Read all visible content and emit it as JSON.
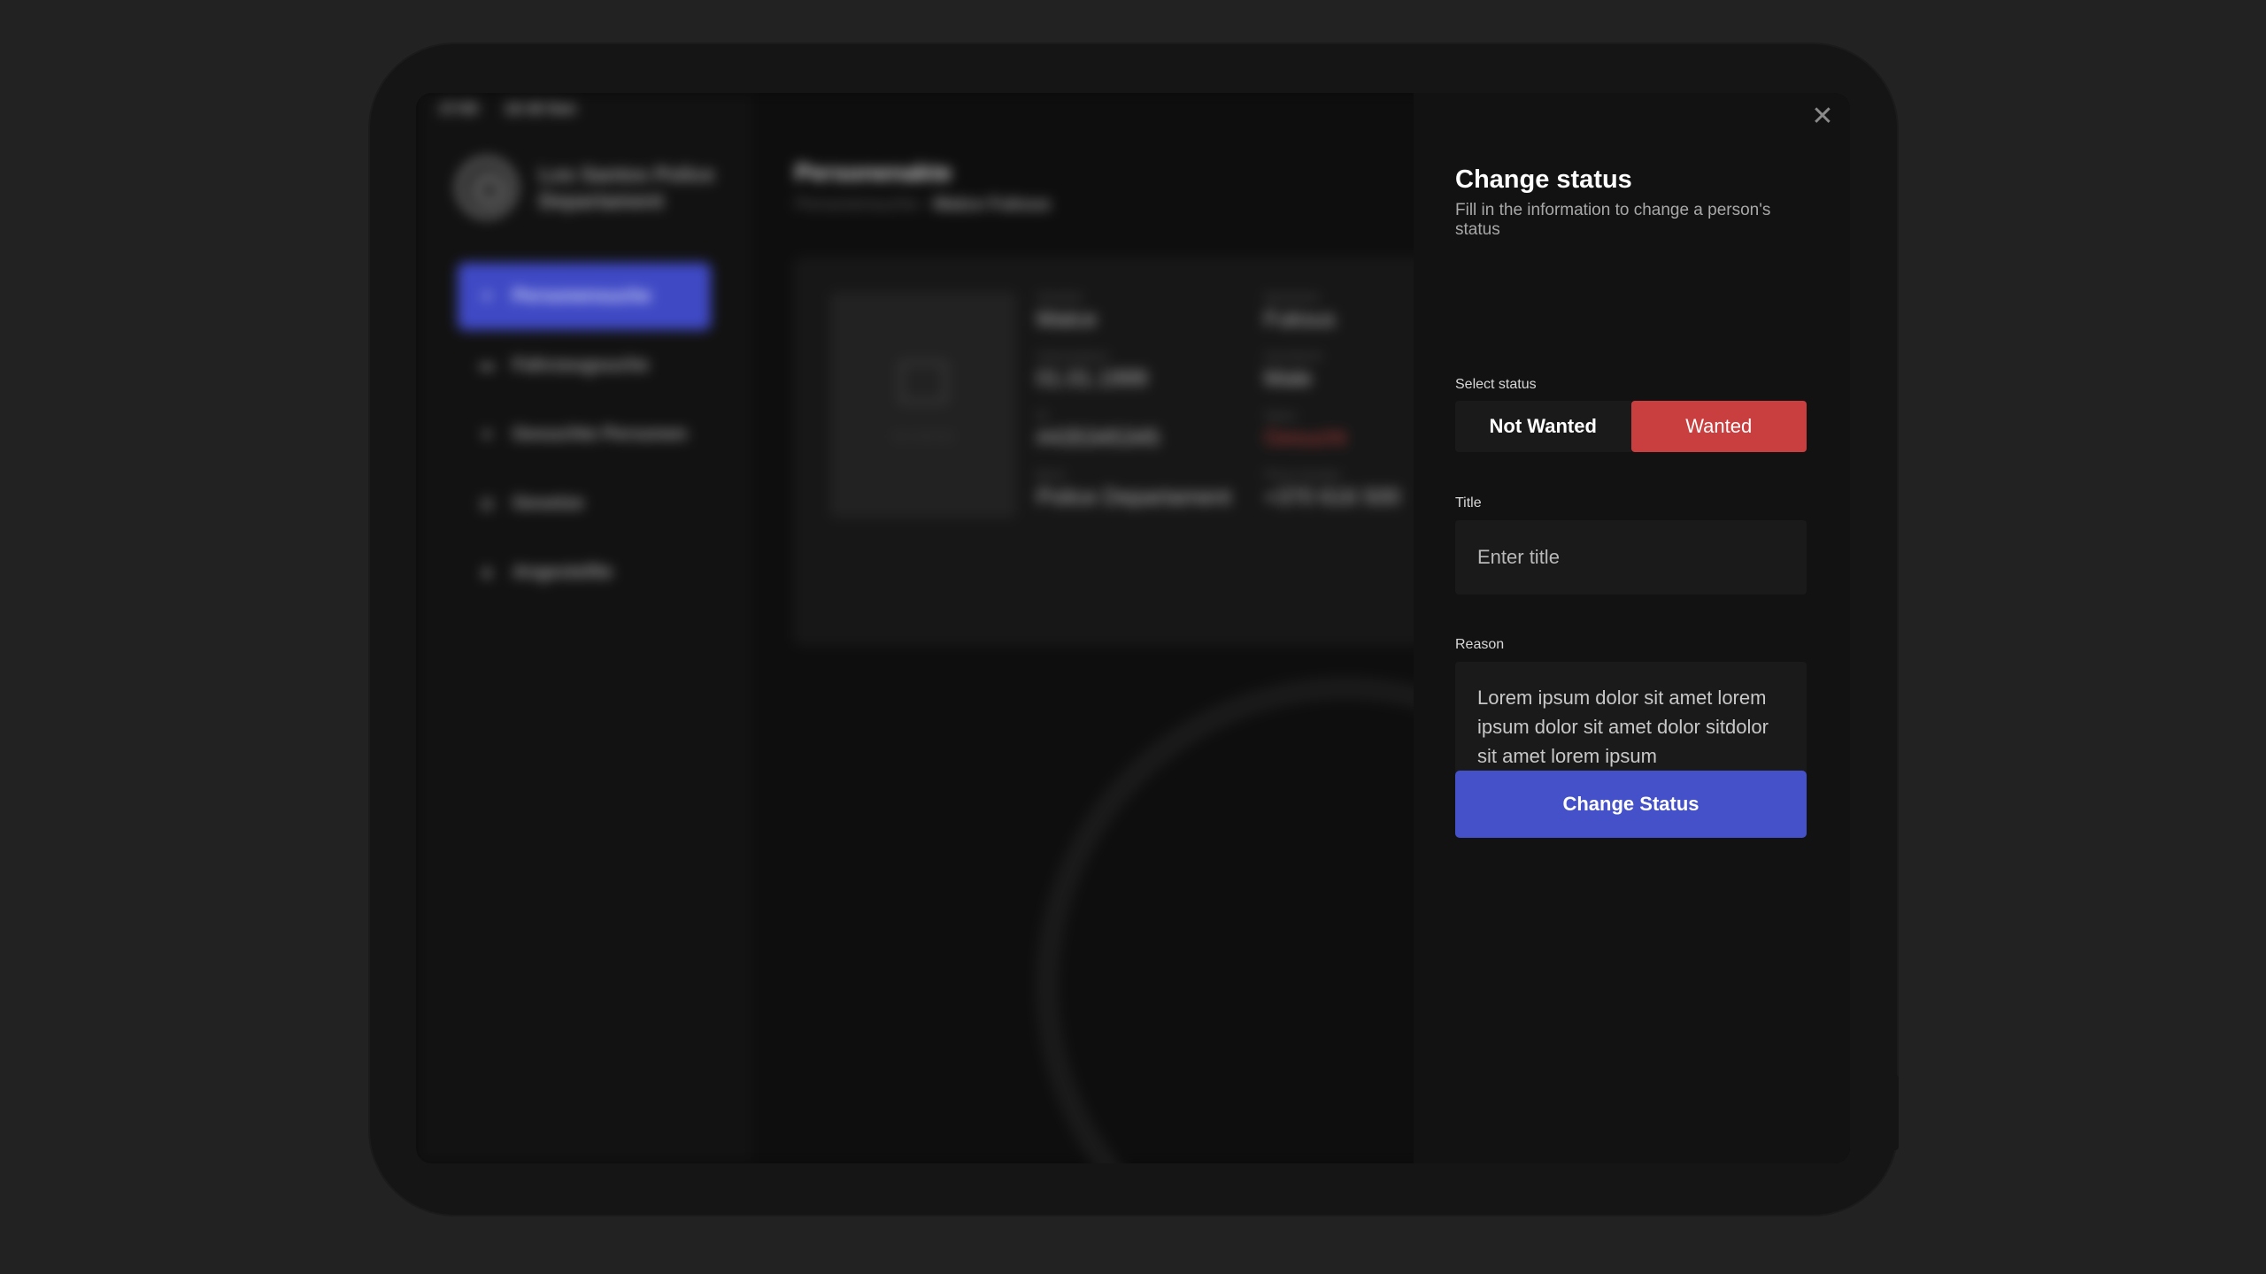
{
  "statusbar": {
    "time": "17:03",
    "date": "12-16 Sun"
  },
  "brand": {
    "name": "Los Santos Police Departament"
  },
  "sidebar": {
    "items": [
      {
        "label": "Personensuche",
        "icon": "person-icon",
        "active": true
      },
      {
        "label": "Fahrzeugsuche",
        "icon": "car-icon",
        "active": false
      },
      {
        "label": "Gesuchte Personen",
        "icon": "star-icon",
        "active": false
      },
      {
        "label": "Gesetze",
        "icon": "book-icon",
        "active": false
      },
      {
        "label": "Angestellte",
        "icon": "people-icon",
        "active": false
      }
    ]
  },
  "main": {
    "title": "Personenakte",
    "breadcrumb": {
      "parent": "Personensuche",
      "separator": "›",
      "current": "Matce Fuksus"
    },
    "person": {
      "photo_placeholder": "NO IMAGE",
      "fields": {
        "firstname": {
          "label": "Vorname",
          "value": "Matce"
        },
        "lastname": {
          "label": "Nachname",
          "value": "Fuksus"
        },
        "birthdate": {
          "label": "Geburtsdatum",
          "value": "01.01.1999"
        },
        "gender": {
          "label": "Geschlecht",
          "value": "Male"
        },
        "id": {
          "label": "ID",
          "value": "#435345345"
        },
        "status": {
          "label": "Status",
          "value": "Gesucht"
        },
        "job": {
          "label": "Beruf",
          "value": "Police Departament"
        },
        "phone": {
          "label": "Phone Number",
          "value": "+370 616 500"
        }
      }
    }
  },
  "panel": {
    "title": "Change status",
    "subtitle": "Fill in the information to change a person's status",
    "select_label": "Select status",
    "options": {
      "not_wanted": "Not Wanted",
      "wanted": "Wanted"
    },
    "selected": "Wanted",
    "title_label": "Title",
    "title_placeholder": "Enter title",
    "reason_label": "Reason",
    "reason_value": "Lorem ipsum dolor sit amet lorem ipsum dolor sit amet dolor sitdolor sit amet lorem ipsum",
    "submit_label": "Change Status",
    "close_glyph": "✕"
  },
  "colors": {
    "accent": "#4451c9",
    "wanted": "#c93e3e",
    "panel_bg": "#121212",
    "page_bg": "#222222"
  }
}
